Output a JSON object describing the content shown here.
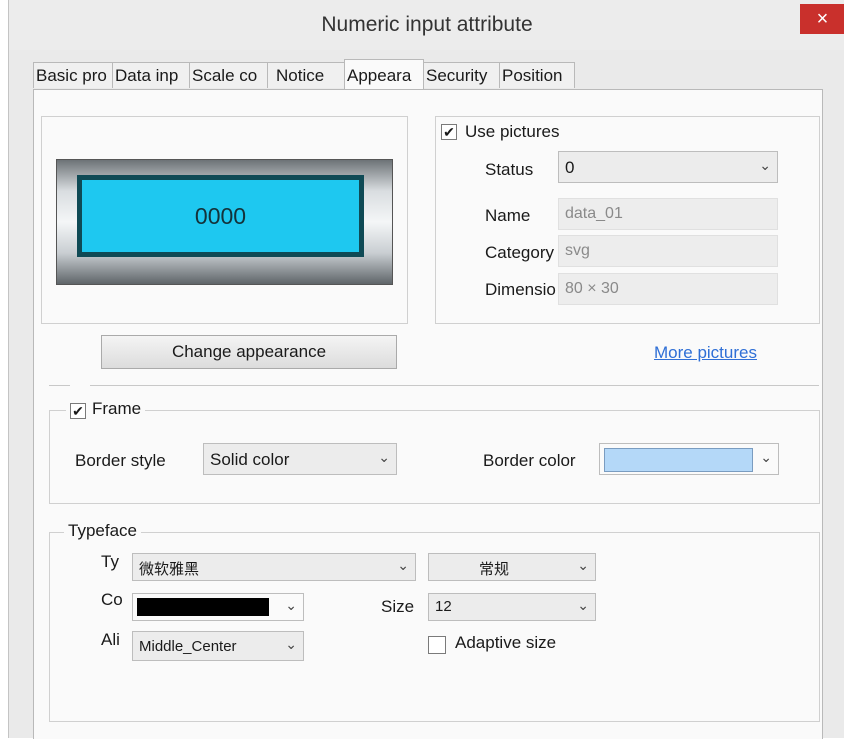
{
  "window": {
    "title": "Numeric input attribute",
    "close_glyph": "×"
  },
  "tabs": [
    {
      "label": "Basic pro"
    },
    {
      "label": "Data inp"
    },
    {
      "label": "Scale co"
    },
    {
      "label": "Notice"
    },
    {
      "label": "Appeara"
    },
    {
      "label": "Security"
    },
    {
      "label": "Position"
    }
  ],
  "preview": {
    "value": "0000"
  },
  "pictures": {
    "use_label": "Use pictures",
    "use_checked": true,
    "status_label": "Status",
    "status_value": "0",
    "name_label": "Name",
    "name_value": "data_01",
    "category_label": "Category",
    "category_value": "svg",
    "dimension_label": "Dimensio",
    "dimension_value": "80 × 30",
    "more_link": "More pictures"
  },
  "change_appearance_label": "Change appearance",
  "frame": {
    "label": "Frame",
    "checked": true,
    "border_style_label": "Border style",
    "border_style_value": "Solid color",
    "border_color_label": "Border color",
    "border_color_swatch": "#b4d8f8"
  },
  "typeface": {
    "legend": "Typeface",
    "type_label": "Ty",
    "font_value": "微软雅黑",
    "style_value": "常规",
    "color_label": "Co",
    "color_swatch": "#000000",
    "size_label": "Size",
    "size_value": "12",
    "align_label": "Ali",
    "align_value": "Middle_Center",
    "adaptive_label": "Adaptive size",
    "adaptive_checked": false
  },
  "colors": {
    "preview_fill": "#1ec8f0",
    "link": "#2f6fd6",
    "close_bg": "#c9302c"
  },
  "icons": {
    "dropdown": "chevron-down-icon",
    "checkmark": "checkmark-icon"
  }
}
